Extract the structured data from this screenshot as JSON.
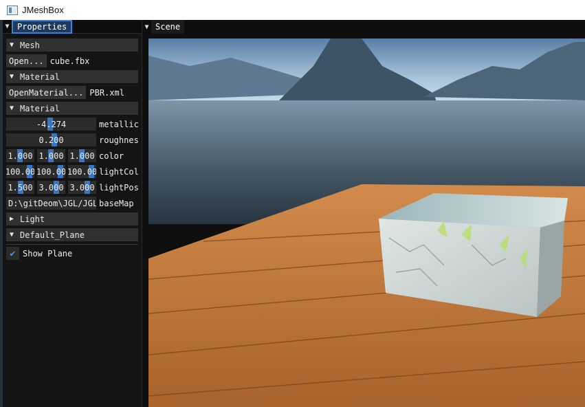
{
  "window": {
    "title": "JMeshBox"
  },
  "properties": {
    "tab_label": "Properties",
    "mesh": {
      "header": "Mesh",
      "open_button": "Open...",
      "file": "cube.fbx"
    },
    "material_file": {
      "header": "Material",
      "open_button": "OpenMaterial...",
      "file": "PBR.xml"
    },
    "material": {
      "header": "Material",
      "metallic": {
        "value": "-4.274",
        "label": "metallic"
      },
      "roughness": {
        "value": "0.200",
        "label": "roughnes"
      },
      "color": {
        "values": [
          "1.000",
          "1.000",
          "1.000"
        ],
        "label": "color"
      },
      "light_color": {
        "values": [
          "100.00",
          "100.00",
          "100.00"
        ],
        "label": "lightCol"
      },
      "light_pos": {
        "values": [
          "1.500",
          "3.000",
          "3.000"
        ],
        "label": "lightPos"
      },
      "base_map": {
        "value": "D:\\gitDeom\\JGL/JGL",
        "label": "baseMap"
      }
    },
    "light": {
      "header": "Light",
      "collapsed": true
    },
    "default_plane": {
      "header": "Default_Plane",
      "show_plane": {
        "label": "Show Plane",
        "checked": true
      }
    }
  },
  "scene": {
    "tab_label": "Scene"
  },
  "icons": {
    "collapse": "triangle-down-icon",
    "expand": "triangle-right-icon",
    "check": "checkmark-icon"
  },
  "colors": {
    "accent": "#3c82d8",
    "panel_bg": "#141414",
    "header_bg": "#303030",
    "field_bg": "#2b2b2b"
  }
}
